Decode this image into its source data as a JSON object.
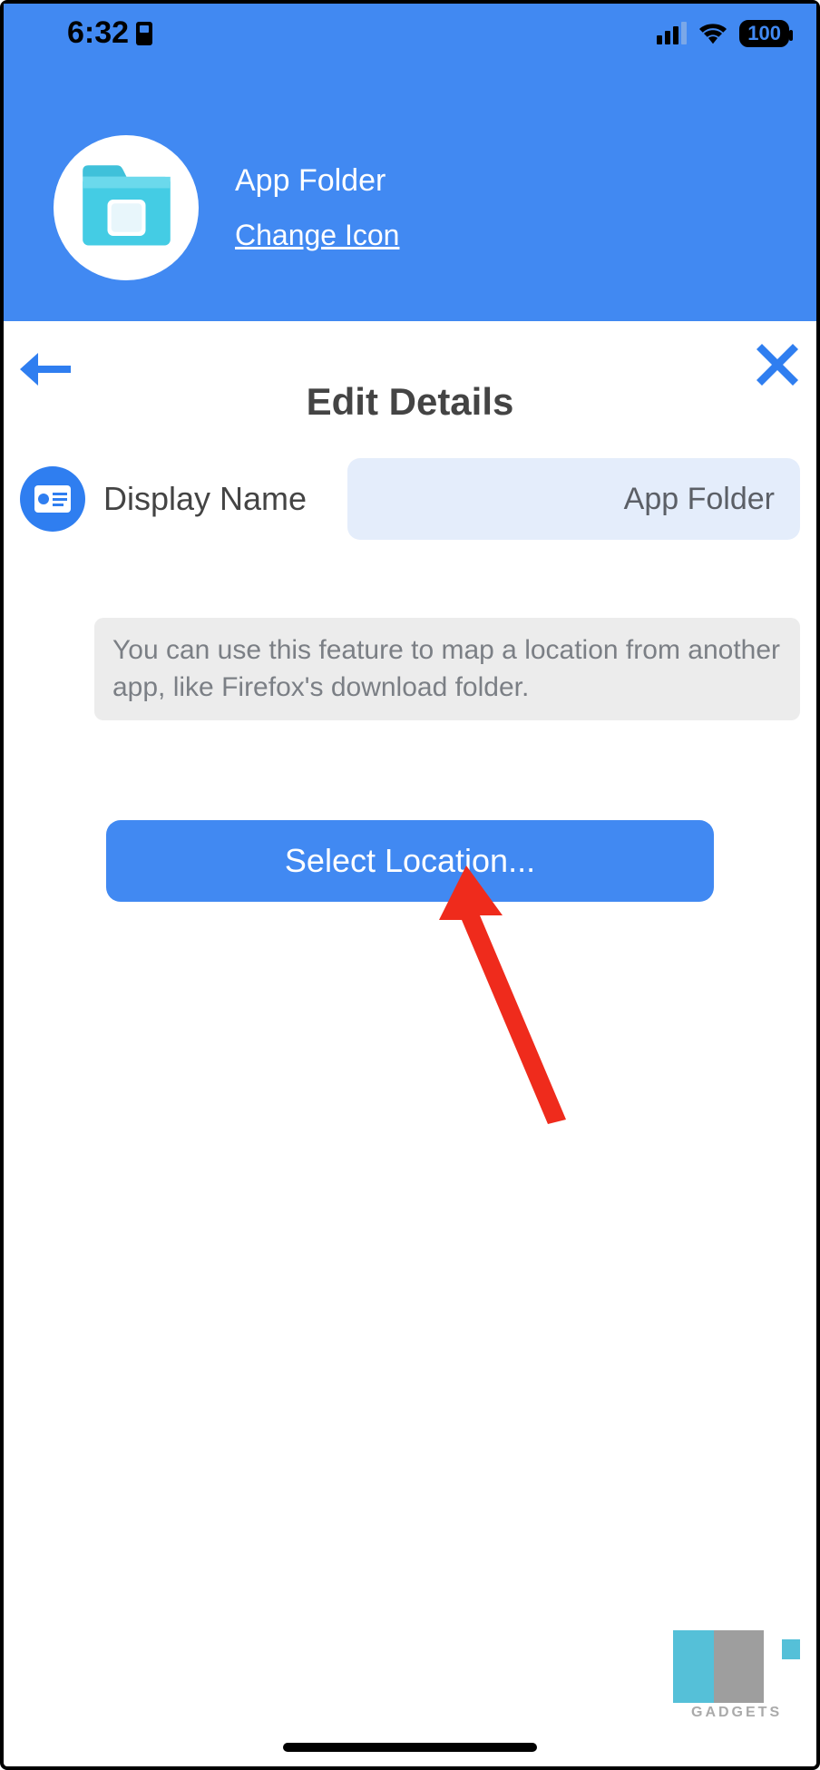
{
  "status": {
    "time": "6:32",
    "battery": "100"
  },
  "header": {
    "title": "App Folder",
    "change_icon": "Change Icon"
  },
  "page": {
    "title": "Edit Details"
  },
  "row": {
    "label": "Display Name",
    "value": "App Folder"
  },
  "hint": "You can use this feature to map a location from another app, like Firefox's download folder.",
  "button": {
    "select_location": "Select Location..."
  },
  "watermark": "GADGETS"
}
